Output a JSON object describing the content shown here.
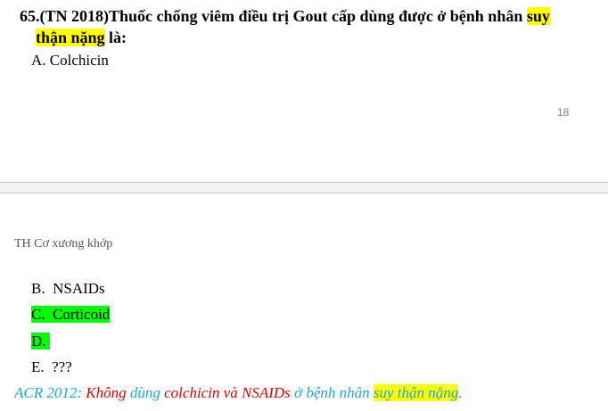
{
  "question": {
    "number": "65.(TN 2018)",
    "text_part1": "Thuốc chống viêm điều trị Gout cấp dùng được ở bệnh nhân ",
    "highlight1": "suy",
    "highlight2": "thận nặng",
    "text_part2": " là:"
  },
  "option_a": "A. Colchicin",
  "page_number": "18",
  "header": "TH Cơ xương khớp",
  "options": {
    "b": "B.  NSAIDs",
    "c": "C.  Corticoid",
    "d": "D. ",
    "e": "E.  ???"
  },
  "acr_note": {
    "part1": "ACR 2012: ",
    "part2": "Không ",
    "part3": "dùng ",
    "part4": "colchicin và NSAIDs ",
    "part5": "ở bệnh nhân ",
    "part6": "suy thận nặng",
    "part7": "."
  },
  "colors": {
    "highlight_yellow": "#ffff00",
    "highlight_green": "#00ff00",
    "note_blue": "#1aa7d6",
    "note_red": "#e00000"
  }
}
